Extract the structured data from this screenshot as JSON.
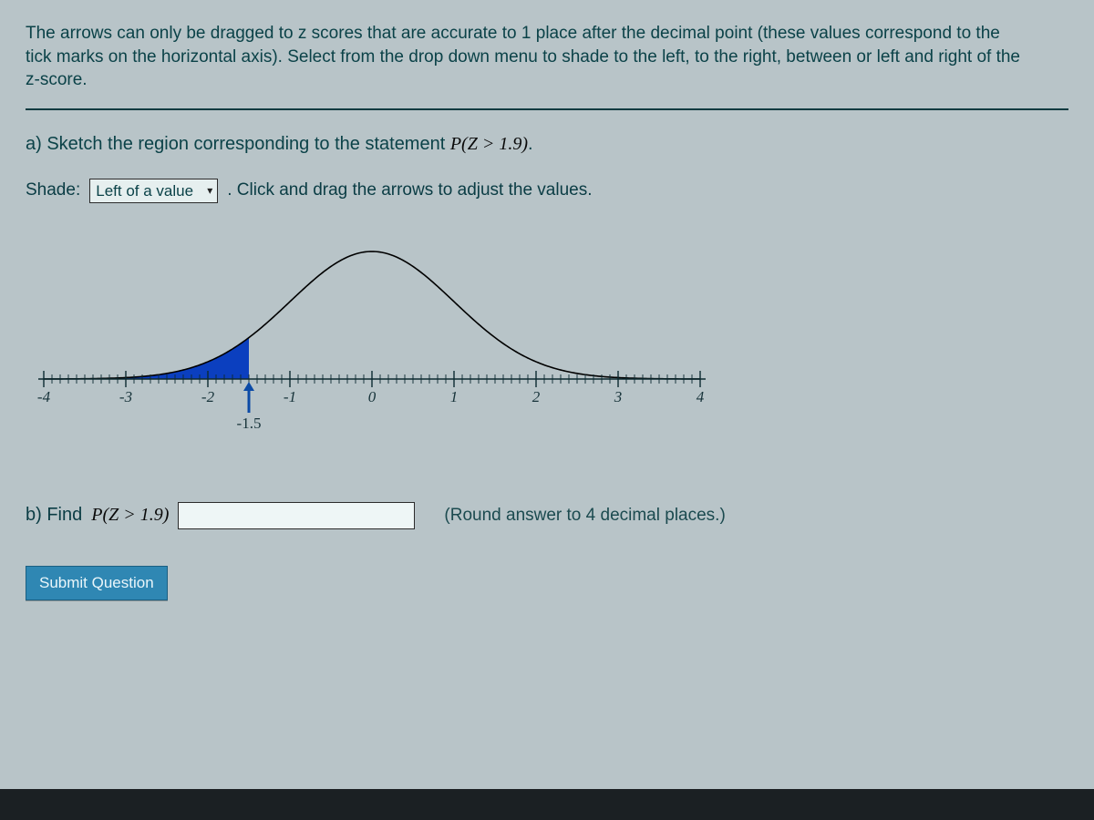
{
  "intro": "The arrows can only be dragged to z scores that are accurate to 1 place after the decimal point (these values correspond to the tick marks on the horizontal axis). Select from the drop down menu to shade to the left, to the right, between or left and right of the z-score.",
  "partA": {
    "prefix": "a) Sketch the region corresponding to the statement ",
    "expr": "P(Z > 1.9)",
    "suffix": "."
  },
  "shade": {
    "label": "Shade:",
    "selected": "Left of a value",
    "after": ". Click and drag the arrows to adjust the values."
  },
  "chart_data": {
    "type": "area",
    "title": "",
    "xlabel": "",
    "ylabel": "",
    "xlim": [
      -4,
      4
    ],
    "ticks": [
      -4,
      -3,
      -2,
      -1,
      0,
      1,
      2,
      3,
      4
    ],
    "minor_tick_step": 0.1,
    "curve": "standard_normal_pdf",
    "shaded_region": {
      "mode": "left_of",
      "z": -1.5
    },
    "arrow_value": -1.5,
    "arrow_label": "-1.5",
    "colors": {
      "curve": "#000000",
      "fill": "#0b3fbf"
    }
  },
  "partB": {
    "prefix": "b) Find ",
    "expr": "P(Z > 1.9)",
    "hint": "(Round answer to 4 decimal places.)",
    "value": ""
  },
  "submit_label": "Submit Question"
}
